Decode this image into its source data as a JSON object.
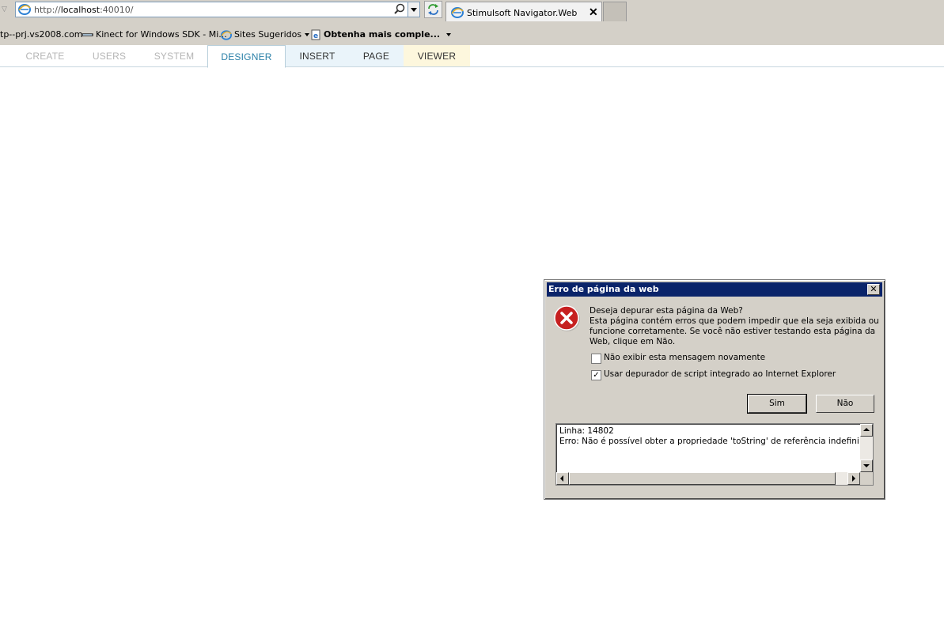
{
  "browser": {
    "address": {
      "prefix": "http://",
      "host": "localhost",
      "port": ":40010/"
    },
    "tab": {
      "title": "Stimulsoft Navigator.Web",
      "close": "✕"
    },
    "favorites": [
      {
        "label": "tp--prj.vs2008.com"
      },
      {
        "label": "Kinect for Windows SDK - Mi..."
      },
      {
        "label": "Sites Sugeridos"
      },
      {
        "label": "Obtenha mais comple..."
      }
    ]
  },
  "app_tabs": [
    {
      "label": "CREATE",
      "state": "disabled"
    },
    {
      "label": "USERS",
      "state": "disabled"
    },
    {
      "label": "SYSTEM",
      "state": "disabled"
    },
    {
      "label": "DESIGNER",
      "state": "active"
    },
    {
      "label": "INSERT",
      "state": "normal"
    },
    {
      "label": "PAGE",
      "state": "normal"
    },
    {
      "label": "VIEWER",
      "state": "normal"
    }
  ],
  "dialog": {
    "title": "Erro de página da web",
    "close": "✕",
    "question": "Deseja depurar esta página da Web?",
    "message": "Esta página contém erros que podem impedir que ela seja exibida ou funcione corretamente. Se você não estiver testando esta página da Web, clique em Não.",
    "checkbox1": {
      "label": "Não exibir esta mensagem novamente",
      "checked": false
    },
    "checkbox2": {
      "label": "Usar depurador de script integrado ao Internet Explorer",
      "checked": true,
      "mark": "✓"
    },
    "yes_button": "Sim",
    "no_button": "Não",
    "details_line1": "Linha: 14802",
    "details_line2": "Erro: Não é possível obter a propriedade 'toString' de referência indefinida ou n"
  },
  "colors": {
    "dialog_title_bar": "#0a246a",
    "active_tab_text": "#2a80a8",
    "error_icon": "#c62020"
  }
}
